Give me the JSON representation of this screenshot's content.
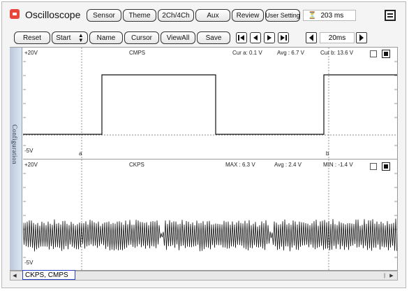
{
  "app": {
    "title": "Oscilloscope"
  },
  "toolbar1": {
    "sensor": "Sensor",
    "theme": "Theme",
    "channels": "2Ch/4Ch",
    "aux": "Aux",
    "review": "Review",
    "user_setting": "User Setting",
    "time_display": "203 ms"
  },
  "toolbar2": {
    "reset": "Reset",
    "start": "Start",
    "name": "Name",
    "cursor": "Cursor",
    "view_all": "ViewAll",
    "save": "Save",
    "zoom": "20ms",
    "nav_icons": [
      "skip-back-icon",
      "step-back-icon",
      "step-forward-icon",
      "skip-forward-icon"
    ]
  },
  "side_tab": {
    "label": "Configuration"
  },
  "channel1": {
    "vmax": "+20V",
    "vmin": "-5V",
    "name": "CMPS",
    "stat1": "Cur a: 0.1 V",
    "stat2": "Avg : 6.7 V",
    "stat3": "Cur b: 13.6 V",
    "cursor_a": "a",
    "cursor_b": "b"
  },
  "channel2": {
    "vmax": "+20V",
    "vmin": "-5V",
    "name": "CKPS",
    "stat1": "MAX : 6.3 V",
    "stat2": "Avg : 2.4 V",
    "stat3": "MIN : -1.4 V"
  },
  "bottom": {
    "channels_label": "CKPS, CMPS"
  }
}
